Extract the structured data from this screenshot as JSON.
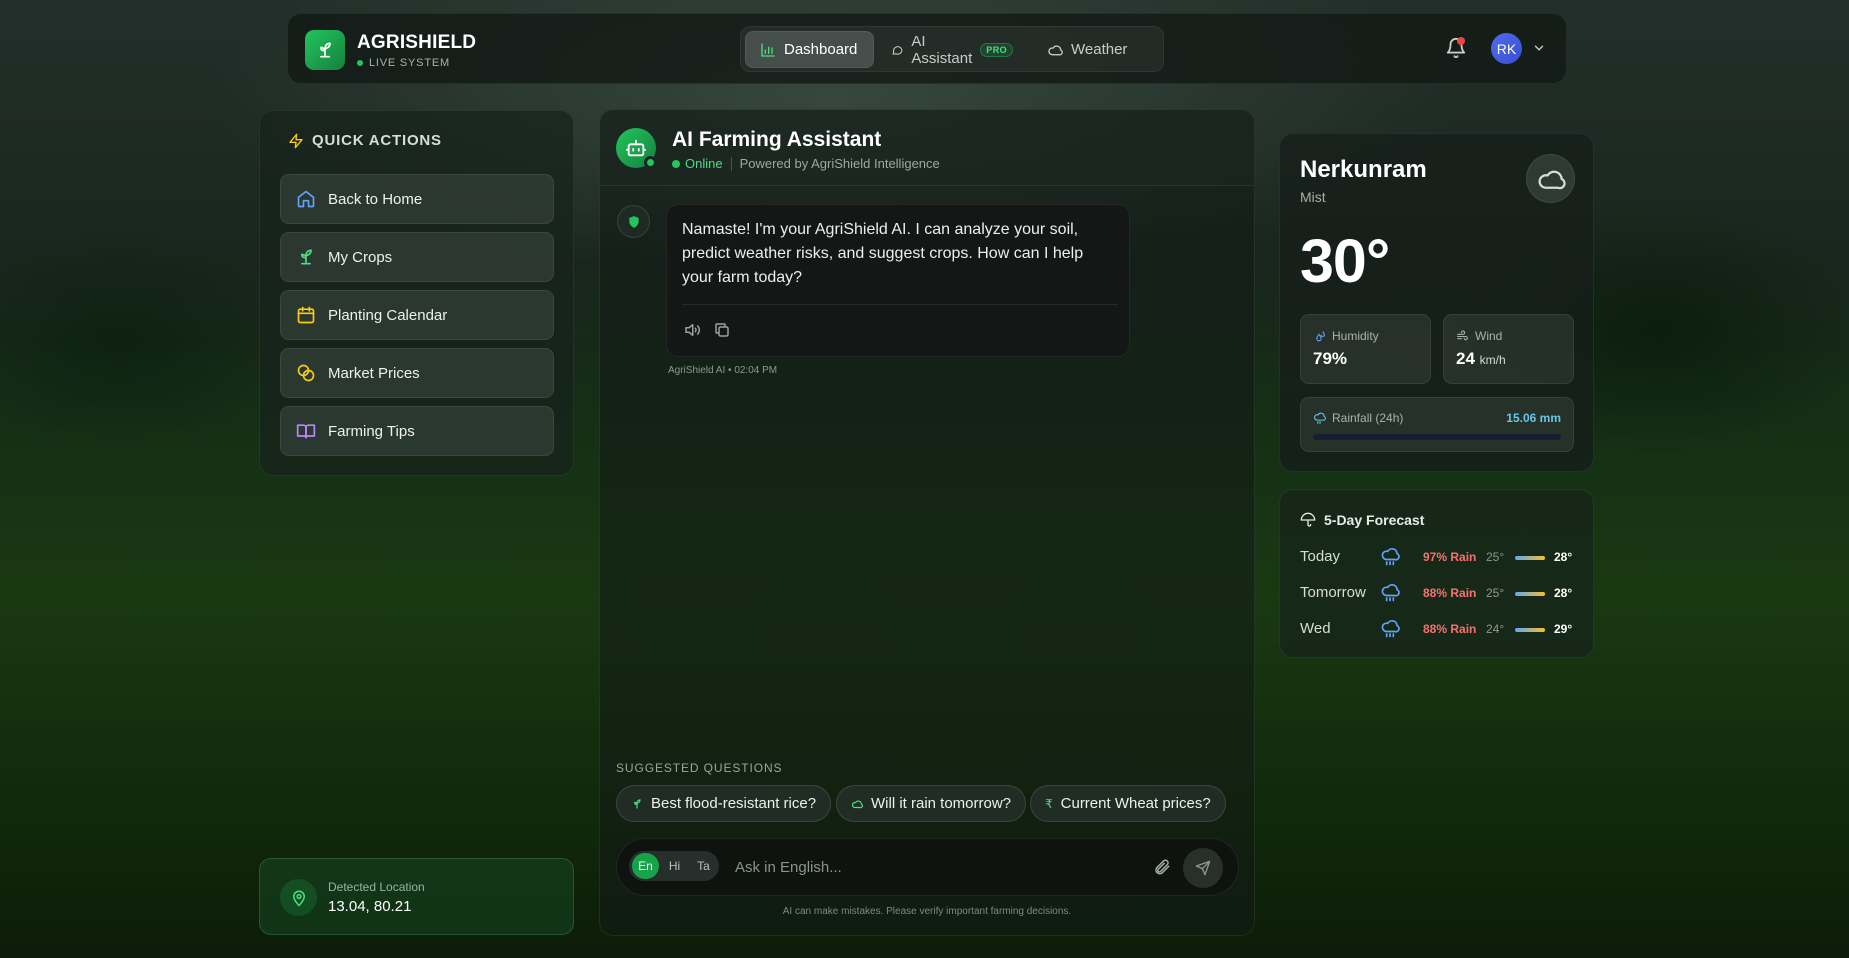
{
  "brand": {
    "name": "AGRISHIELD",
    "status": "LIVE SYSTEM"
  },
  "nav": {
    "tabs": [
      {
        "label": "Dashboard",
        "active": true
      },
      {
        "label": "AI Assistant",
        "badge": "PRO"
      },
      {
        "label": "Weather"
      }
    ]
  },
  "user": {
    "initials": "RK"
  },
  "quick_actions": {
    "title": "QUICK ACTIONS",
    "items": [
      {
        "label": "Back to Home",
        "icon": "home-icon"
      },
      {
        "label": "My Crops",
        "icon": "sprout-icon"
      },
      {
        "label": "Planting Calendar",
        "icon": "calendar-icon"
      },
      {
        "label": "Market Prices",
        "icon": "coins-icon"
      },
      {
        "label": "Farming Tips",
        "icon": "book-icon"
      }
    ]
  },
  "location": {
    "label": "Detected Location",
    "value": "13.04, 80.21"
  },
  "chat": {
    "title": "AI Farming Assistant",
    "status": "Online",
    "powered_by": "Powered by AgriShield Intelligence",
    "message": {
      "text": "Namaste! I'm your AgriShield AI. I can analyze your soil, predict weather risks, and suggest crops. How can I help your farm today?",
      "meta": "AgriShield AI • 02:04 PM"
    },
    "suggested_label": "SUGGESTED QUESTIONS",
    "suggestions": [
      {
        "label": "Best flood-resistant rice?",
        "icon": "sprout-icon"
      },
      {
        "label": "Will it rain tomorrow?",
        "icon": "cloud-icon"
      },
      {
        "label": "Current Wheat prices?",
        "icon": "rupee-icon"
      }
    ],
    "languages": [
      "En",
      "Hi",
      "Ta"
    ],
    "active_language": "En",
    "input_placeholder": "Ask in English...",
    "disclaimer": "AI can make mistakes. Please verify important farming decisions."
  },
  "weather": {
    "city": "Nerkunram",
    "condition": "Mist",
    "temperature": "30°",
    "humidity": {
      "label": "Humidity",
      "value": "79%"
    },
    "wind": {
      "label": "Wind",
      "value": "24",
      "unit": "km/h"
    },
    "rainfall": {
      "label": "Rainfall (24h)",
      "value": "15.06 mm",
      "fill_percent": 0
    }
  },
  "forecast": {
    "title": "5-Day Forecast",
    "days": [
      {
        "day": "Today",
        "rain": "97% Rain",
        "min": "25°",
        "max": "28°"
      },
      {
        "day": "Tomorrow",
        "rain": "88% Rain",
        "min": "25°",
        "max": "28°"
      },
      {
        "day": "Wed",
        "rain": "88% Rain",
        "min": "24°",
        "max": "29°"
      }
    ]
  },
  "colors": {
    "accent": "#22c55e",
    "rain": "#f87171",
    "rainfall": "#67c7e6"
  }
}
